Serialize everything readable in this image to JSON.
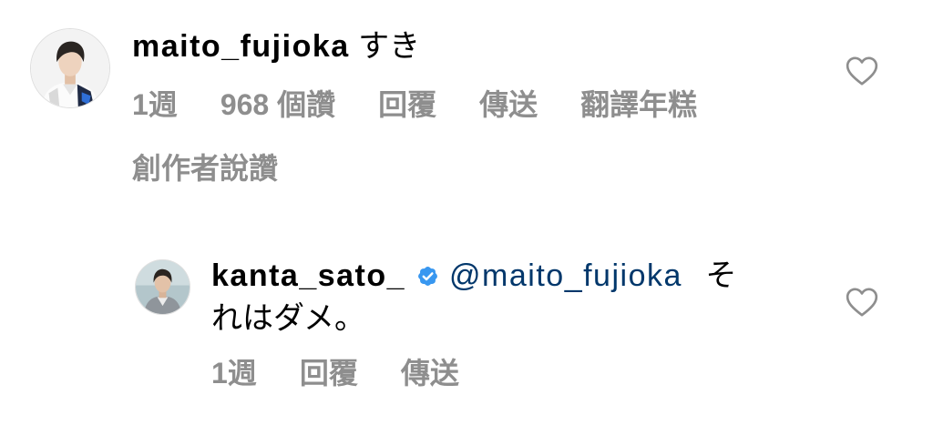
{
  "colors": {
    "background": "#ffffff",
    "text": "#000000",
    "secondary": "#8e8e8e",
    "link": "#00376b",
    "verified": "#3897f0",
    "icon": "#8e8e8e"
  },
  "comment": {
    "username": "maito_fujioka",
    "text": "すき",
    "like_icon": "heart-outline-icon",
    "meta": {
      "time": "1週",
      "likes": "968 個讚",
      "reply": "回覆",
      "send": "傳送",
      "translate": "翻譯年糕"
    },
    "creator_liked": "創作者說讚"
  },
  "reply": {
    "username": "kanta_sato_",
    "verified": true,
    "verified_icon": "verified-badge-icon",
    "mention": "@maito_fujioka",
    "text": "それはダメ。",
    "like_icon": "heart-outline-icon",
    "meta": {
      "time": "1週",
      "reply": "回覆",
      "send": "傳送"
    }
  }
}
